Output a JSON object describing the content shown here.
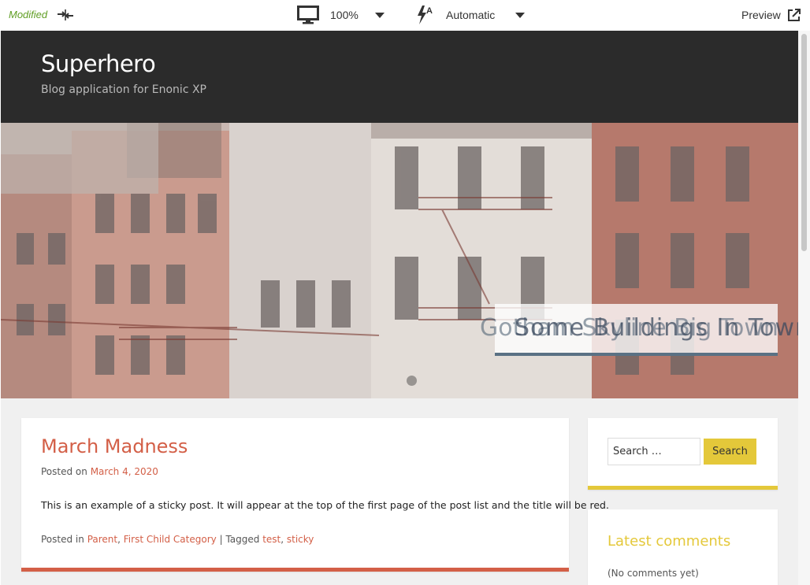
{
  "toolbar": {
    "status": "Modified",
    "zoom": "100%",
    "mode": "Automatic",
    "preview_label": "Preview",
    "icons": [
      "sync-icon",
      "monitor-icon",
      "bolt-icon",
      "external-link-icon"
    ]
  },
  "site": {
    "title": "Superhero",
    "description": "Blog application for Enonic XP"
  },
  "hero": {
    "caption_back": "Gotham Skyline Big Town",
    "caption_front": "Some Buildings In Town"
  },
  "post": {
    "title": "March Madness",
    "posted_on": "Posted on",
    "date": "March 4, 2020",
    "body": "This is an example of a sticky post. It will appear at the top of the first page of the post list and the title will be red.",
    "posted_in": "Posted in",
    "categories": [
      "Parent",
      "First Child Category"
    ],
    "tagged": "Tagged",
    "tags": [
      "test",
      "sticky"
    ]
  },
  "sidebar": {
    "search_placeholder": "Search …",
    "search_button": "Search",
    "comments_title": "Latest comments",
    "comments_text": "(No comments yet)"
  },
  "colors": {
    "accent_red": "#d35f47",
    "accent_yellow": "#e4c83a",
    "modified_green": "#609e24",
    "header_dark": "#2b2b2b"
  }
}
